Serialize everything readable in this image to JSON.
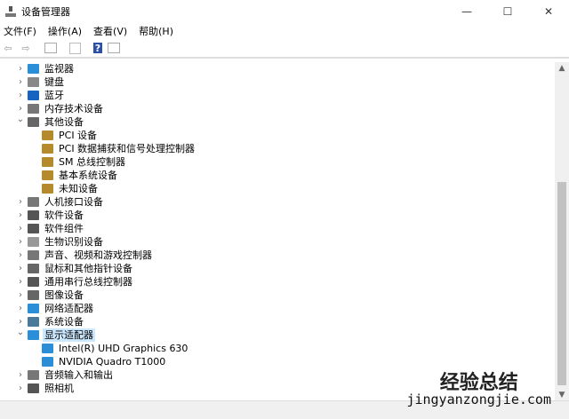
{
  "window": {
    "title": "设备管理器",
    "minimize": "—",
    "maximize": "☐",
    "close": "✕"
  },
  "menu": [
    "文件(F)",
    "操作(A)",
    "查看(V)",
    "帮助(H)"
  ],
  "toolbar": [
    "back-icon",
    "forward-icon",
    "properties-icon",
    "scan-icon",
    "help-icon",
    "update-icon"
  ],
  "tree": [
    {
      "label": "监视器",
      "level": 0,
      "expanded": false,
      "icon": "monitor",
      "color": "#2a8fd8"
    },
    {
      "label": "键盘",
      "level": 0,
      "expanded": false,
      "icon": "keyboard",
      "color": "#888"
    },
    {
      "label": "蓝牙",
      "level": 0,
      "expanded": false,
      "icon": "bluetooth",
      "color": "#1565c0"
    },
    {
      "label": "内存技术设备",
      "level": 0,
      "expanded": false,
      "icon": "memory",
      "color": "#777"
    },
    {
      "label": "其他设备",
      "level": 0,
      "expanded": true,
      "icon": "other",
      "color": "#666"
    },
    {
      "label": "PCI 设备",
      "level": 1,
      "icon": "warning",
      "color": "#b58a2a"
    },
    {
      "label": "PCI 数据捕获和信号处理控制器",
      "level": 1,
      "icon": "warning",
      "color": "#b58a2a"
    },
    {
      "label": "SM 总线控制器",
      "level": 1,
      "icon": "warning",
      "color": "#b58a2a"
    },
    {
      "label": "基本系统设备",
      "level": 1,
      "icon": "warning",
      "color": "#b58a2a"
    },
    {
      "label": "未知设备",
      "level": 1,
      "icon": "warning",
      "color": "#b58a2a"
    },
    {
      "label": "人机接口设备",
      "level": 0,
      "expanded": false,
      "icon": "hid",
      "color": "#777"
    },
    {
      "label": "软件设备",
      "level": 0,
      "expanded": false,
      "icon": "software",
      "color": "#555"
    },
    {
      "label": "软件组件",
      "level": 0,
      "expanded": false,
      "icon": "component",
      "color": "#555"
    },
    {
      "label": "生物识别设备",
      "level": 0,
      "expanded": false,
      "icon": "biometric",
      "color": "#999"
    },
    {
      "label": "声音、视频和游戏控制器",
      "level": 0,
      "expanded": false,
      "icon": "sound",
      "color": "#777"
    },
    {
      "label": "鼠标和其他指针设备",
      "level": 0,
      "expanded": false,
      "icon": "mouse",
      "color": "#666"
    },
    {
      "label": "通用串行总线控制器",
      "level": 0,
      "expanded": false,
      "icon": "usb",
      "color": "#555"
    },
    {
      "label": "图像设备",
      "level": 0,
      "expanded": false,
      "icon": "imaging",
      "color": "#666"
    },
    {
      "label": "网络适配器",
      "level": 0,
      "expanded": false,
      "icon": "network",
      "color": "#2a8fd8"
    },
    {
      "label": "系统设备",
      "level": 0,
      "expanded": false,
      "icon": "system",
      "color": "#4a7a9a"
    },
    {
      "label": "显示适配器",
      "level": 0,
      "expanded": true,
      "selected": true,
      "icon": "display",
      "color": "#2a8fd8"
    },
    {
      "label": "Intel(R) UHD Graphics 630",
      "level": 1,
      "icon": "display",
      "color": "#2a8fd8"
    },
    {
      "label": "NVIDIA Quadro T1000",
      "level": 1,
      "icon": "display",
      "color": "#2a8fd8"
    },
    {
      "label": "音频输入和输出",
      "level": 0,
      "expanded": false,
      "icon": "audio",
      "color": "#777"
    },
    {
      "label": "照相机",
      "level": 0,
      "expanded": false,
      "icon": "camera",
      "color": "#555"
    }
  ],
  "watermark": {
    "title": "经验总结",
    "url": "jingyanzongjie.com"
  }
}
